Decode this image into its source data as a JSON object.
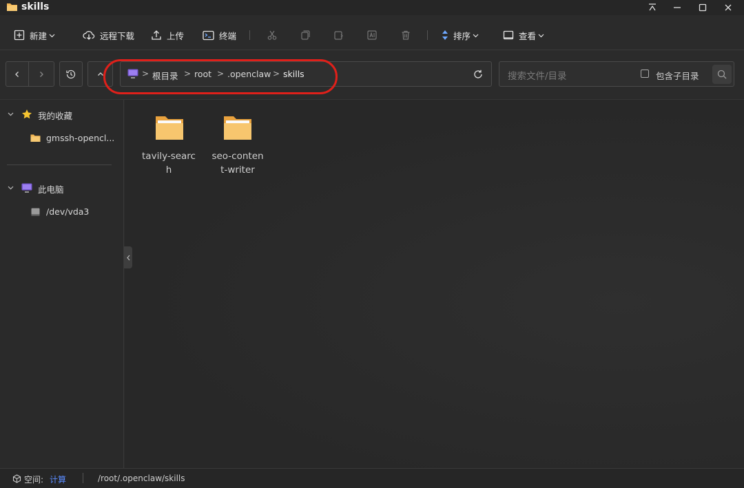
{
  "window": {
    "title": "skills"
  },
  "toolbar": {
    "new_label": "新建",
    "remote_download_label": "远程下载",
    "upload_label": "上传",
    "terminal_label": "终端",
    "sort_label": "排序",
    "view_label": "查看"
  },
  "breadcrumb": {
    "items": [
      "根目录",
      "root",
      ".openclaw",
      "skills"
    ]
  },
  "search": {
    "placeholder": "搜索文件/目录",
    "include_subdirs_label": "包含子目录"
  },
  "sidebar": {
    "favorites_label": "我的收藏",
    "favorite_items": [
      "gmssh-opencl..."
    ],
    "computer_label": "此电脑",
    "drives": [
      "/dev/vda3"
    ]
  },
  "files": [
    {
      "name_line1": "tavily-searc",
      "name_line2": "h"
    },
    {
      "name_line1": "seo-conten",
      "name_line2": "t-writer"
    }
  ],
  "status": {
    "space_label": "空间:",
    "space_value": "计算",
    "path": "/root/.openclaw/skills"
  },
  "colors": {
    "accent_blue": "#5b8cff",
    "highlight_ring": "#e0201a",
    "folder": "#f2b654"
  }
}
